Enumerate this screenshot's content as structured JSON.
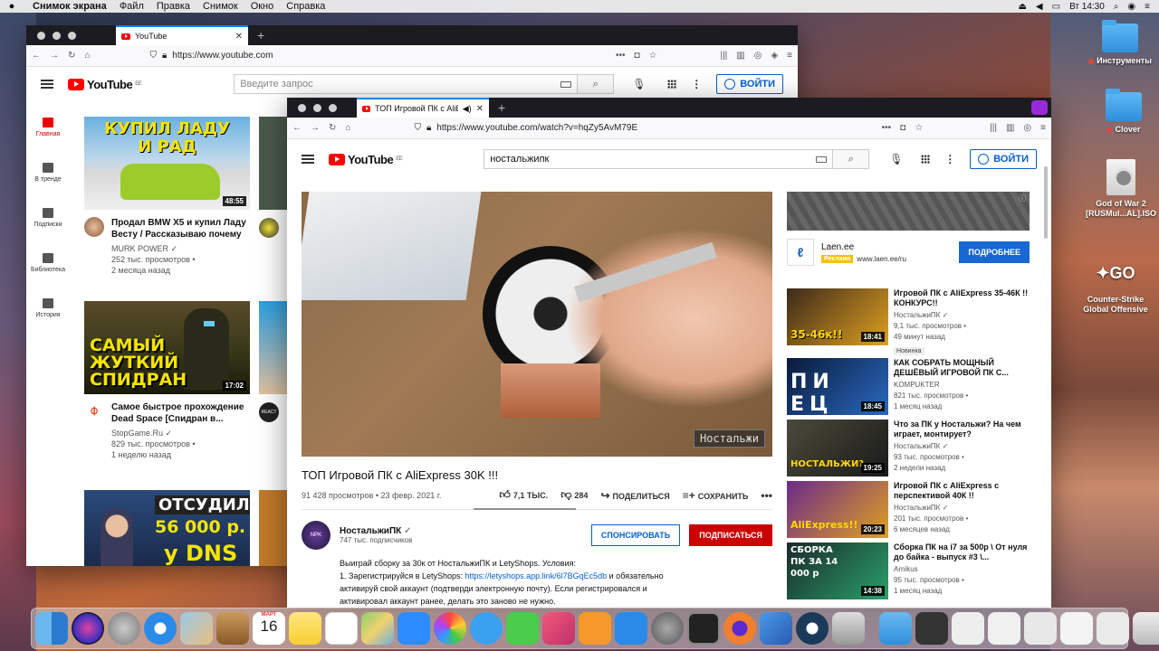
{
  "menubar": {
    "app": "Снимок экрана",
    "items": [
      "Файл",
      "Правка",
      "Снимок",
      "Окно",
      "Справка"
    ],
    "clock": "Вт 14:30"
  },
  "desktop": {
    "icons": [
      {
        "label": "Инструменты",
        "tag": "red"
      },
      {
        "label": "Clover",
        "tag": "red"
      },
      {
        "label": "God of War 2 [RUSMul...AL].ISO"
      },
      {
        "label": "Counter-Strike Global Offensive"
      }
    ]
  },
  "back": {
    "tab_title": "YouTube",
    "url": "https://www.youtube.com",
    "search_placeholder": "Введите запрос",
    "signin": "ВОЙТИ",
    "logo_region": "EE",
    "nav": [
      {
        "label": "Главная",
        "icon": "home-icon"
      },
      {
        "label": "В тренде",
        "icon": "trending-icon"
      },
      {
        "label": "Подписки",
        "icon": "subscriptions-icon"
      },
      {
        "label": "Библиотека",
        "icon": "library-icon"
      },
      {
        "label": "История",
        "icon": "history-icon"
      }
    ],
    "videos": [
      {
        "thumb_text": "КУПИЛ ЛАДУ И РАД",
        "duration": "48:55",
        "title": "Продал BMW X5 и купил Ладу Весту / Рассказываю почему",
        "channel": "MURK POWER",
        "views": "252 тыс. просмотров",
        "date": "2 месяца назад"
      },
      {
        "thumb_text": "САМЫЙ ЖУТКИЙ СПИДРАН",
        "duration": "17:02",
        "title": "Самое быстрое прохождение Dead Space [Спидран в...",
        "channel": "StopGame.Ru",
        "views": "829 тыс. просмотров",
        "date": "1 неделю назад"
      },
      {
        "thumb_text_top": "ОТСУДИЛ",
        "thumb_text_mid": "56 000 р.",
        "thumb_text_bot": "у DNS"
      }
    ]
  },
  "front": {
    "tab_title": "ТОП Игровой ПК с AliExpre",
    "url": "https://www.youtube.com/watch?v=hqZy5AvM79E",
    "search_value": "ностальжипк",
    "signin": "ВОЙТИ",
    "logo_region": "EE",
    "video": {
      "watermark": "Ностальжи",
      "title": "ТОП Игровой ПК с AliExpress 30K !!!",
      "meta": "91 428 просмотров • 23 февр. 2021 г.",
      "likes": "7,1 ТЫС.",
      "dislikes": "284",
      "share": "ПОДЕЛИТЬСЯ",
      "save": "СОХРАНИТЬ"
    },
    "channel": {
      "name": "НостальжиПК",
      "subs": "747 тыс. подписчиков",
      "sponsor": "СПОНСИРОВАТЬ",
      "subscribe": "ПОДПИСАТЬСЯ"
    },
    "description": {
      "line1": "Выиграй сборку за 30к от НостальжиПК и LetyShops. Условия:",
      "line2_prefix": "1. Зарегистрируйся в LetyShops: ",
      "line2_link": "https://letyshops.app.link/6l7BGqEc5db",
      "line2_suffix": " и обязательно",
      "line3": "активируй свой аккаунт (подтверди электронную почту). Если регистрировался и",
      "line4": "активировал аккаунт ранее, делать это заново не нужно."
    },
    "ad": {
      "name": "Laen.ee",
      "badge": "Реклама",
      "domain": "www.laen.ee/ru",
      "button": "ПОДРОБНЕЕ"
    },
    "recommended": [
      {
        "title": "Игровой ПК с AliExpress 35-46К !!КОНКУРС!!",
        "channel": "НостальжиПК",
        "views": "9,1 тыс. просмотров",
        "date": "49 минут назад",
        "duration": "18:41",
        "badge": "Новинка",
        "thumb_text": "35-46к!!"
      },
      {
        "title": "КАК СОБРАТЬ МОЩНЫЙ ДЕШЁВЫЙ ИГРОВОЙ ПК С...",
        "channel": "KOMPUKTER",
        "views": "821 тыс. просмотров",
        "date": "1 месяц назад",
        "duration": "18:45",
        "thumb_text": "ПИ ЕЦ"
      },
      {
        "title": "Что за ПК у Ностальжи? На чем играет, монтирует?",
        "channel": "НостальжиПК",
        "views": "93 тыс. просмотров",
        "date": "2 недели назад",
        "duration": "19:25",
        "thumb_text": "НОСТАЛЬЖИ?"
      },
      {
        "title": "Игровой ПК с AliExpress с перспективой 40К !!",
        "channel": "НостальжиПК",
        "views": "201 тыс. просмотров",
        "date": "6 месяцев назад",
        "duration": "20:23",
        "thumb_text": "AliExpress!!"
      },
      {
        "title": "Сборка ПК на i7 за 500р \\ От нуля до байка - выпуск #3 \\...",
        "channel": "Arnikus",
        "views": "95 тыс. просмотров",
        "date": "1 месяц назад",
        "duration": "14:38",
        "thumb_text": "СБОРКА ПК ЗА 14 000 р"
      }
    ]
  },
  "dock": {
    "calendar_month": "МАРТ",
    "calendar_day": "16"
  }
}
